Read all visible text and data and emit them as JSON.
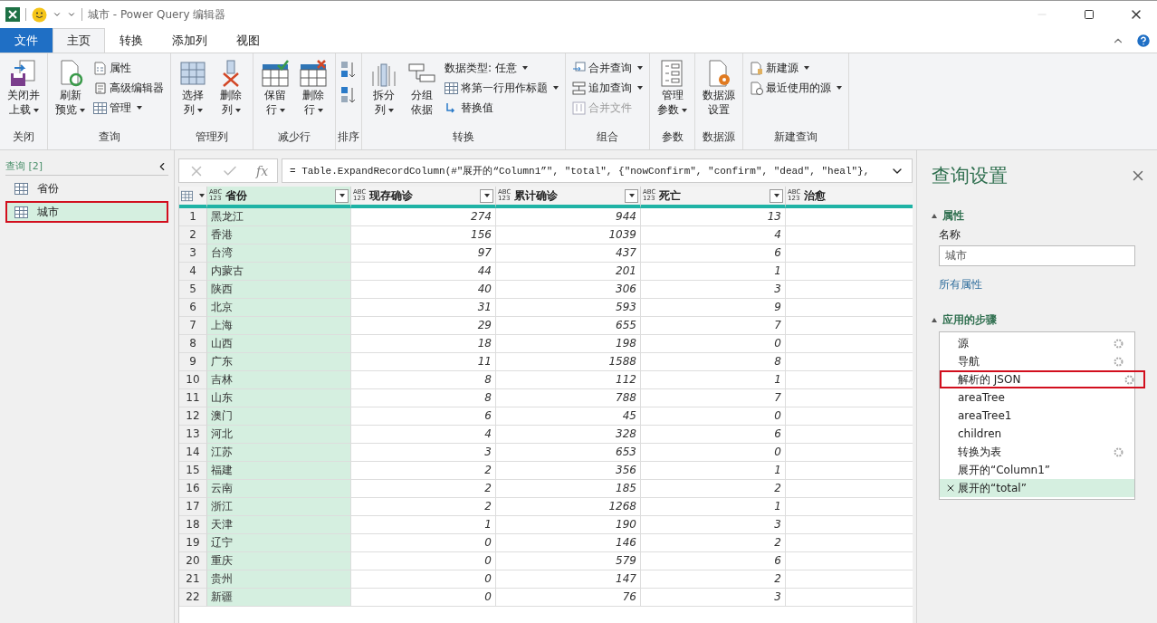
{
  "window": {
    "title": "城市 - Power Query 编辑器"
  },
  "ribbon_tabs": [
    {
      "label": "文件",
      "kind": "file",
      "selected": false
    },
    {
      "label": "主页",
      "kind": "tab",
      "selected": true
    },
    {
      "label": "转换",
      "kind": "tab",
      "selected": false
    },
    {
      "label": "添加列",
      "kind": "tab",
      "selected": false
    },
    {
      "label": "视图",
      "kind": "tab",
      "selected": false
    }
  ],
  "ribbon_groups": [
    {
      "label": "关闭",
      "items": [
        {
          "kind": "large",
          "lines": [
            "关闭并",
            "上载"
          ],
          "dropdown": true
        }
      ]
    },
    {
      "label": "查询",
      "items": [
        {
          "kind": "large",
          "lines": [
            "刷新",
            "预览"
          ],
          "dropdown": true
        },
        {
          "kind": "stack",
          "items": [
            {
              "label": "属性",
              "dropdown": false,
              "disabled": false
            },
            {
              "label": "高级编辑器",
              "dropdown": false,
              "disabled": false
            },
            {
              "label": "管理",
              "dropdown": true,
              "disabled": false
            }
          ]
        }
      ]
    },
    {
      "label": "管理列",
      "items": [
        {
          "kind": "large",
          "lines": [
            "选择",
            "列"
          ],
          "dropdown": true
        },
        {
          "kind": "large",
          "lines": [
            "删除",
            "列"
          ],
          "dropdown": true
        }
      ]
    },
    {
      "label": "减少行",
      "items": [
        {
          "kind": "large",
          "lines": [
            "保留",
            "行"
          ],
          "dropdown": true
        },
        {
          "kind": "large",
          "lines": [
            "删除",
            "行"
          ],
          "dropdown": true
        }
      ]
    },
    {
      "label": "排序",
      "items": [
        {
          "kind": "sort"
        }
      ]
    },
    {
      "label": "转换",
      "items": [
        {
          "kind": "large",
          "lines": [
            "拆分",
            "列"
          ],
          "dropdown": true
        },
        {
          "kind": "large",
          "lines": [
            "分组",
            "依据"
          ],
          "dropdown": false
        },
        {
          "kind": "stack",
          "items": [
            {
              "label": "数据类型: 任意",
              "dropdown": true,
              "disabled": false
            },
            {
              "label": "将第一行用作标题",
              "dropdown": true,
              "disabled": false
            },
            {
              "label": "替换值",
              "dropdown": false,
              "disabled": false
            }
          ]
        }
      ]
    },
    {
      "label": "组合",
      "items": [
        {
          "kind": "stack",
          "items": [
            {
              "label": "合并查询",
              "dropdown": true,
              "disabled": false
            },
            {
              "label": "追加查询",
              "dropdown": true,
              "disabled": false
            },
            {
              "label": "合并文件",
              "dropdown": false,
              "disabled": true
            }
          ]
        }
      ]
    },
    {
      "label": "参数",
      "items": [
        {
          "kind": "large",
          "lines": [
            "管理",
            "参数"
          ],
          "dropdown": true
        }
      ]
    },
    {
      "label": "数据源",
      "items": [
        {
          "kind": "large",
          "lines": [
            "数据源",
            "设置"
          ],
          "dropdown": false
        }
      ]
    },
    {
      "label": "新建查询",
      "items": [
        {
          "kind": "stack",
          "items": [
            {
              "label": "新建源",
              "dropdown": true,
              "disabled": false
            },
            {
              "label": "最近使用的源",
              "dropdown": true,
              "disabled": false
            }
          ]
        }
      ]
    }
  ],
  "queries": {
    "title": "查询 [2]",
    "items": [
      {
        "label": "省份",
        "selected": false,
        "highlighted": false
      },
      {
        "label": "城市",
        "selected": true,
        "highlighted": true
      }
    ]
  },
  "formula_bar": {
    "fx_label": "fx",
    "formula": "= Table.ExpandRecordColumn(#\"展开的“Column1”\", \"total\", {\"nowConfirm\", \"confirm\", \"dead\", \"heal\"},"
  },
  "table": {
    "columns": [
      {
        "name": "省份",
        "type": [
          "ABC",
          "123"
        ],
        "selected": true,
        "filter": true
      },
      {
        "name": "现存确诊",
        "type": [
          "ABC",
          "123"
        ],
        "selected": false,
        "filter": true
      },
      {
        "name": "累计确诊",
        "type": [
          "ABC",
          "123"
        ],
        "selected": false,
        "filter": true
      },
      {
        "name": "死亡",
        "type": [
          "ABC",
          "123"
        ],
        "selected": false,
        "filter": true
      },
      {
        "name": "治愈",
        "type": [
          "ABC",
          "123"
        ],
        "selected": false
      }
    ],
    "rows": [
      {
        "n": "1",
        "cells": [
          "黑龙江",
          "274",
          "944",
          "13"
        ]
      },
      {
        "n": "2",
        "cells": [
          "香港",
          "156",
          "1039",
          "4"
        ]
      },
      {
        "n": "3",
        "cells": [
          "台湾",
          "97",
          "437",
          "6"
        ]
      },
      {
        "n": "4",
        "cells": [
          "内蒙古",
          "44",
          "201",
          "1"
        ]
      },
      {
        "n": "5",
        "cells": [
          "陕西",
          "40",
          "306",
          "3"
        ]
      },
      {
        "n": "6",
        "cells": [
          "北京",
          "31",
          "593",
          "9"
        ]
      },
      {
        "n": "7",
        "cells": [
          "上海",
          "29",
          "655",
          "7"
        ]
      },
      {
        "n": "8",
        "cells": [
          "山西",
          "18",
          "198",
          "0"
        ]
      },
      {
        "n": "9",
        "cells": [
          "广东",
          "11",
          "1588",
          "8"
        ]
      },
      {
        "n": "10",
        "cells": [
          "吉林",
          "8",
          "112",
          "1"
        ]
      },
      {
        "n": "11",
        "cells": [
          "山东",
          "8",
          "788",
          "7"
        ]
      },
      {
        "n": "12",
        "cells": [
          "澳门",
          "6",
          "45",
          "0"
        ]
      },
      {
        "n": "13",
        "cells": [
          "河北",
          "4",
          "328",
          "6"
        ]
      },
      {
        "n": "14",
        "cells": [
          "江苏",
          "3",
          "653",
          "0"
        ]
      },
      {
        "n": "15",
        "cells": [
          "福建",
          "2",
          "356",
          "1"
        ]
      },
      {
        "n": "16",
        "cells": [
          "云南",
          "2",
          "185",
          "2"
        ]
      },
      {
        "n": "17",
        "cells": [
          "浙江",
          "2",
          "1268",
          "1"
        ]
      },
      {
        "n": "18",
        "cells": [
          "天津",
          "1",
          "190",
          "3"
        ]
      },
      {
        "n": "19",
        "cells": [
          "辽宁",
          "0",
          "146",
          "2"
        ]
      },
      {
        "n": "20",
        "cells": [
          "重庆",
          "0",
          "579",
          "6"
        ]
      },
      {
        "n": "21",
        "cells": [
          "贵州",
          "0",
          "147",
          "2"
        ]
      },
      {
        "n": "22",
        "cells": [
          "新疆",
          "0",
          "76",
          "3"
        ]
      }
    ]
  },
  "query_settings": {
    "title": "查询设置",
    "properties_title": "属性",
    "name_label": "名称",
    "name_value": "城市",
    "all_properties": "所有属性",
    "steps_title": "应用的步骤",
    "steps": [
      {
        "label": "源",
        "gear": true,
        "selected": false,
        "highlighted": false
      },
      {
        "label": "导航",
        "gear": true,
        "selected": false,
        "highlighted": false
      },
      {
        "label": "解析的 JSON",
        "gear": true,
        "selected": false,
        "highlighted": true
      },
      {
        "label": "areaTree",
        "gear": false,
        "selected": false,
        "highlighted": false
      },
      {
        "label": "areaTree1",
        "gear": false,
        "selected": false,
        "highlighted": false
      },
      {
        "label": "children",
        "gear": false,
        "selected": false,
        "highlighted": false
      },
      {
        "label": "转换为表",
        "gear": true,
        "selected": false,
        "highlighted": false
      },
      {
        "label": "展开的“Column1”",
        "gear": false,
        "selected": false,
        "highlighted": false
      },
      {
        "label": "展开的“total”",
        "gear": false,
        "selected": true,
        "highlighted": false
      }
    ]
  }
}
